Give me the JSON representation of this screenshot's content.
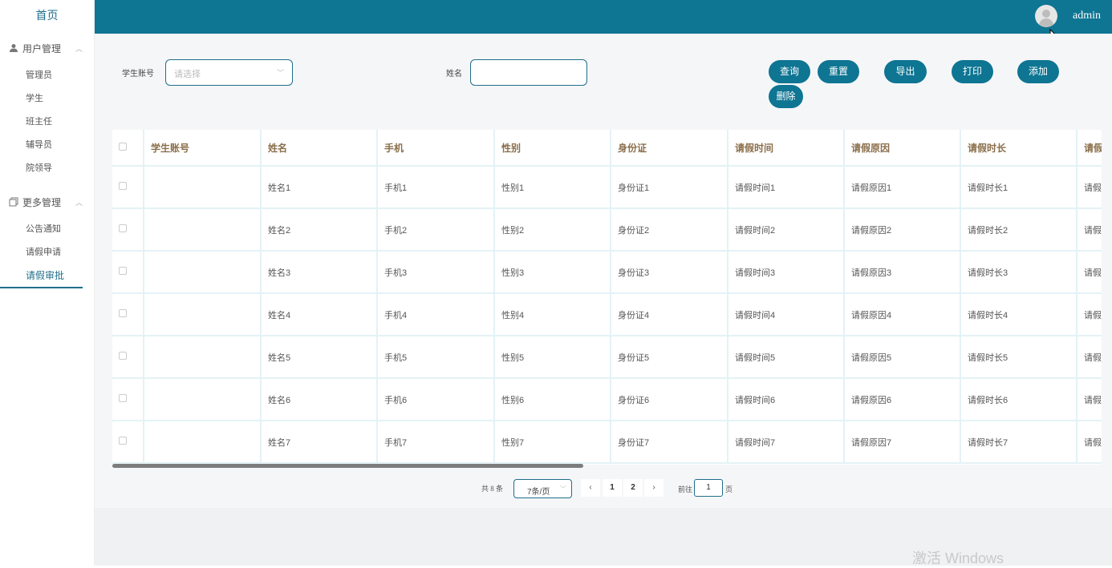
{
  "sidebar": {
    "home": "首页",
    "groups": [
      {
        "label": "用户管理",
        "items": [
          "管理员",
          "学生",
          "班主任",
          "辅导员",
          "院领导"
        ]
      },
      {
        "label": "更多管理",
        "items": [
          "公告通知",
          "请假申请",
          "请假审批"
        ]
      }
    ],
    "active_item": "请假审批"
  },
  "header": {
    "username": "admin"
  },
  "search": {
    "student_account_label": "学生账号",
    "student_account_placeholder": "请选择",
    "name_label": "姓名",
    "name_value": ""
  },
  "buttons": {
    "query": "查询",
    "reset": "重置",
    "export": "导出",
    "print": "打印",
    "add": "添加",
    "delete": "删除"
  },
  "table": {
    "columns": [
      "学生账号",
      "姓名",
      "手机",
      "性别",
      "身份证",
      "请假时间",
      "请假原因",
      "请假时长",
      "请假"
    ],
    "rows": [
      [
        "",
        "姓名1",
        "手机1",
        "性别1",
        "身份证1",
        "请假时间1",
        "请假原因1",
        "请假时长1",
        "请假"
      ],
      [
        "",
        "姓名2",
        "手机2",
        "性别2",
        "身份证2",
        "请假时间2",
        "请假原因2",
        "请假时长2",
        "请假"
      ],
      [
        "",
        "姓名3",
        "手机3",
        "性别3",
        "身份证3",
        "请假时间3",
        "请假原因3",
        "请假时长3",
        "请假"
      ],
      [
        "",
        "姓名4",
        "手机4",
        "性别4",
        "身份证4",
        "请假时间4",
        "请假原因4",
        "请假时长4",
        "请假"
      ],
      [
        "",
        "姓名5",
        "手机5",
        "性别5",
        "身份证5",
        "请假时间5",
        "请假原因5",
        "请假时长5",
        "请假"
      ],
      [
        "",
        "姓名6",
        "手机6",
        "性别6",
        "身份证6",
        "请假时间6",
        "请假原因6",
        "请假时长6",
        "请假"
      ],
      [
        "",
        "姓名7",
        "手机7",
        "性别7",
        "身份证7",
        "请假时间7",
        "请假原因7",
        "请假时长7",
        "请假"
      ]
    ]
  },
  "pagination": {
    "total": "共 8 条",
    "page_size": "7条/页",
    "prev": "‹",
    "pages": [
      "1",
      "2"
    ],
    "next": "›",
    "goto_label": "前往",
    "goto_value": "1",
    "page_suffix": "页"
  },
  "watermark": "激活 Windows",
  "colors": {
    "primary": "#0e7593",
    "header_text": "#8a6e4a"
  }
}
